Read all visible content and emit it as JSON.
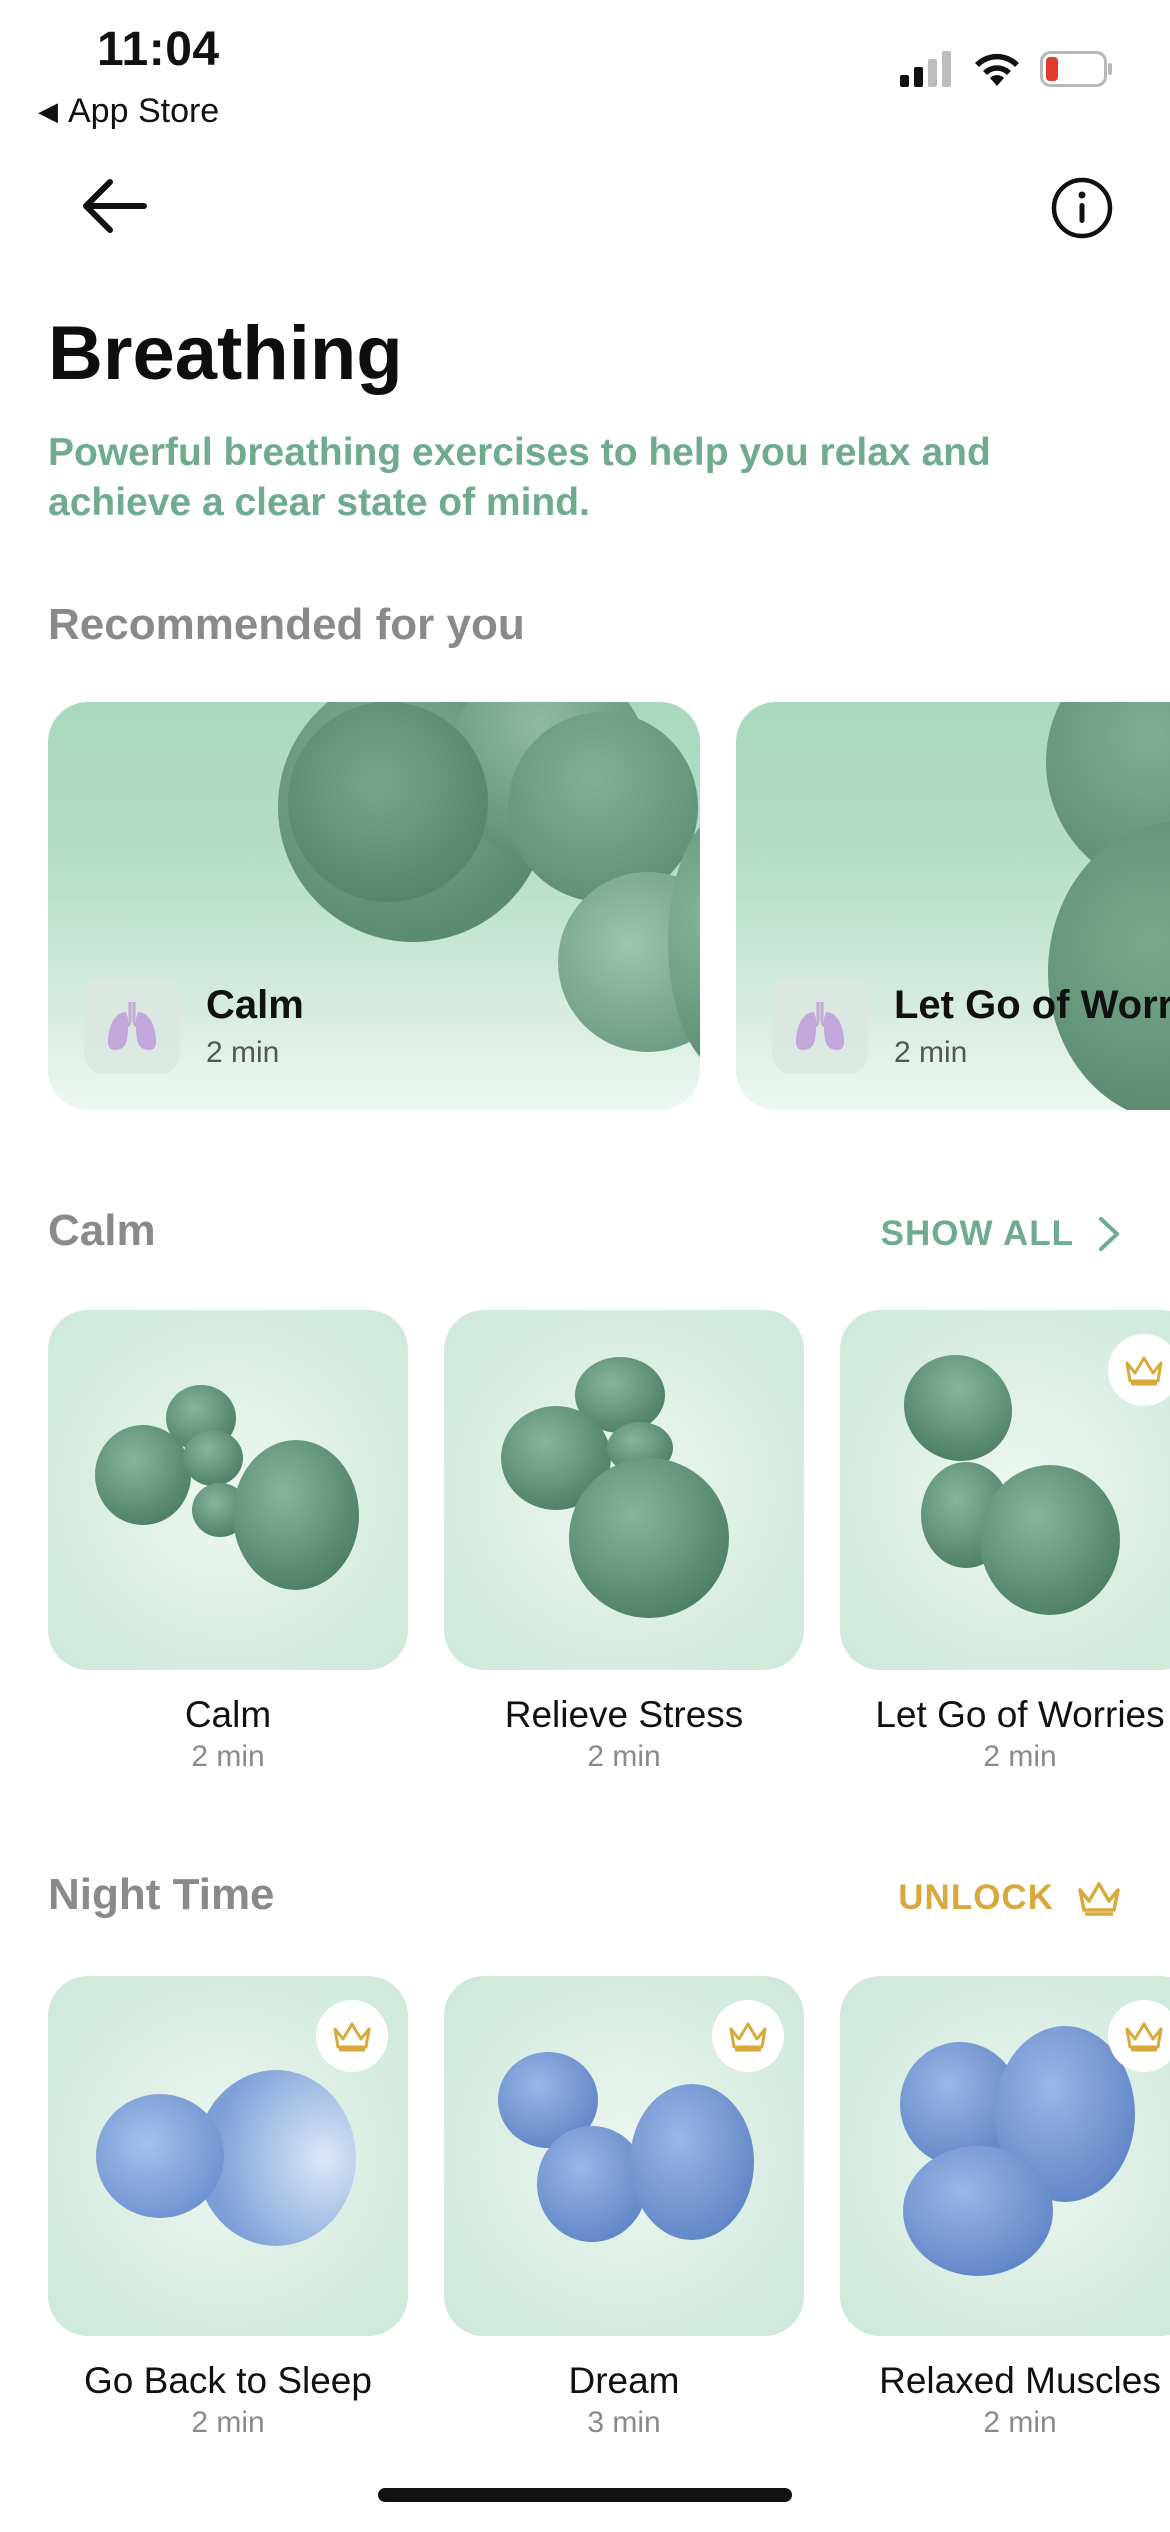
{
  "status_bar": {
    "time": "11:04",
    "back_app": "App Store",
    "back_icon": "triangle-left-icon",
    "battery_color": "#e23b30"
  },
  "nav": {
    "back_icon": "arrow-left-icon",
    "info_icon": "info-icon"
  },
  "header": {
    "title": "Breathing",
    "subtitle": "Powerful breathing exercises to help you relax and achieve a clear state of mind."
  },
  "recommended": {
    "title": "Recommended for you",
    "cards": [
      {
        "name": "Calm",
        "duration": "2 min",
        "icon": "lungs-icon"
      },
      {
        "name": "Let Go of Worries",
        "duration": "2 min",
        "icon": "lungs-icon"
      }
    ]
  },
  "calm_section": {
    "title": "Calm",
    "action": "SHOW ALL",
    "action_icon": "chevron-right-icon",
    "items": [
      {
        "name": "Calm",
        "duration": "2 min",
        "locked": false
      },
      {
        "name": "Relieve Stress",
        "duration": "2 min",
        "locked": false
      },
      {
        "name": "Let Go of Worries",
        "duration": "2 min",
        "locked": true
      }
    ]
  },
  "night_section": {
    "title": "Night Time",
    "action": "UNLOCK",
    "action_icon": "crown-icon",
    "items": [
      {
        "name": "Go Back to Sleep",
        "duration": "2 min",
        "locked": true
      },
      {
        "name": "Dream",
        "duration": "3 min",
        "locked": true
      },
      {
        "name": "Relaxed Muscles",
        "duration": "2 min",
        "locked": true
      }
    ]
  },
  "colors": {
    "accent_green": "#6fab8f",
    "gold": "#d8aa3c",
    "section_gray": "#8a8a8a",
    "blob_green": "#5e9478",
    "blob_blue": "#7c9fd8"
  }
}
